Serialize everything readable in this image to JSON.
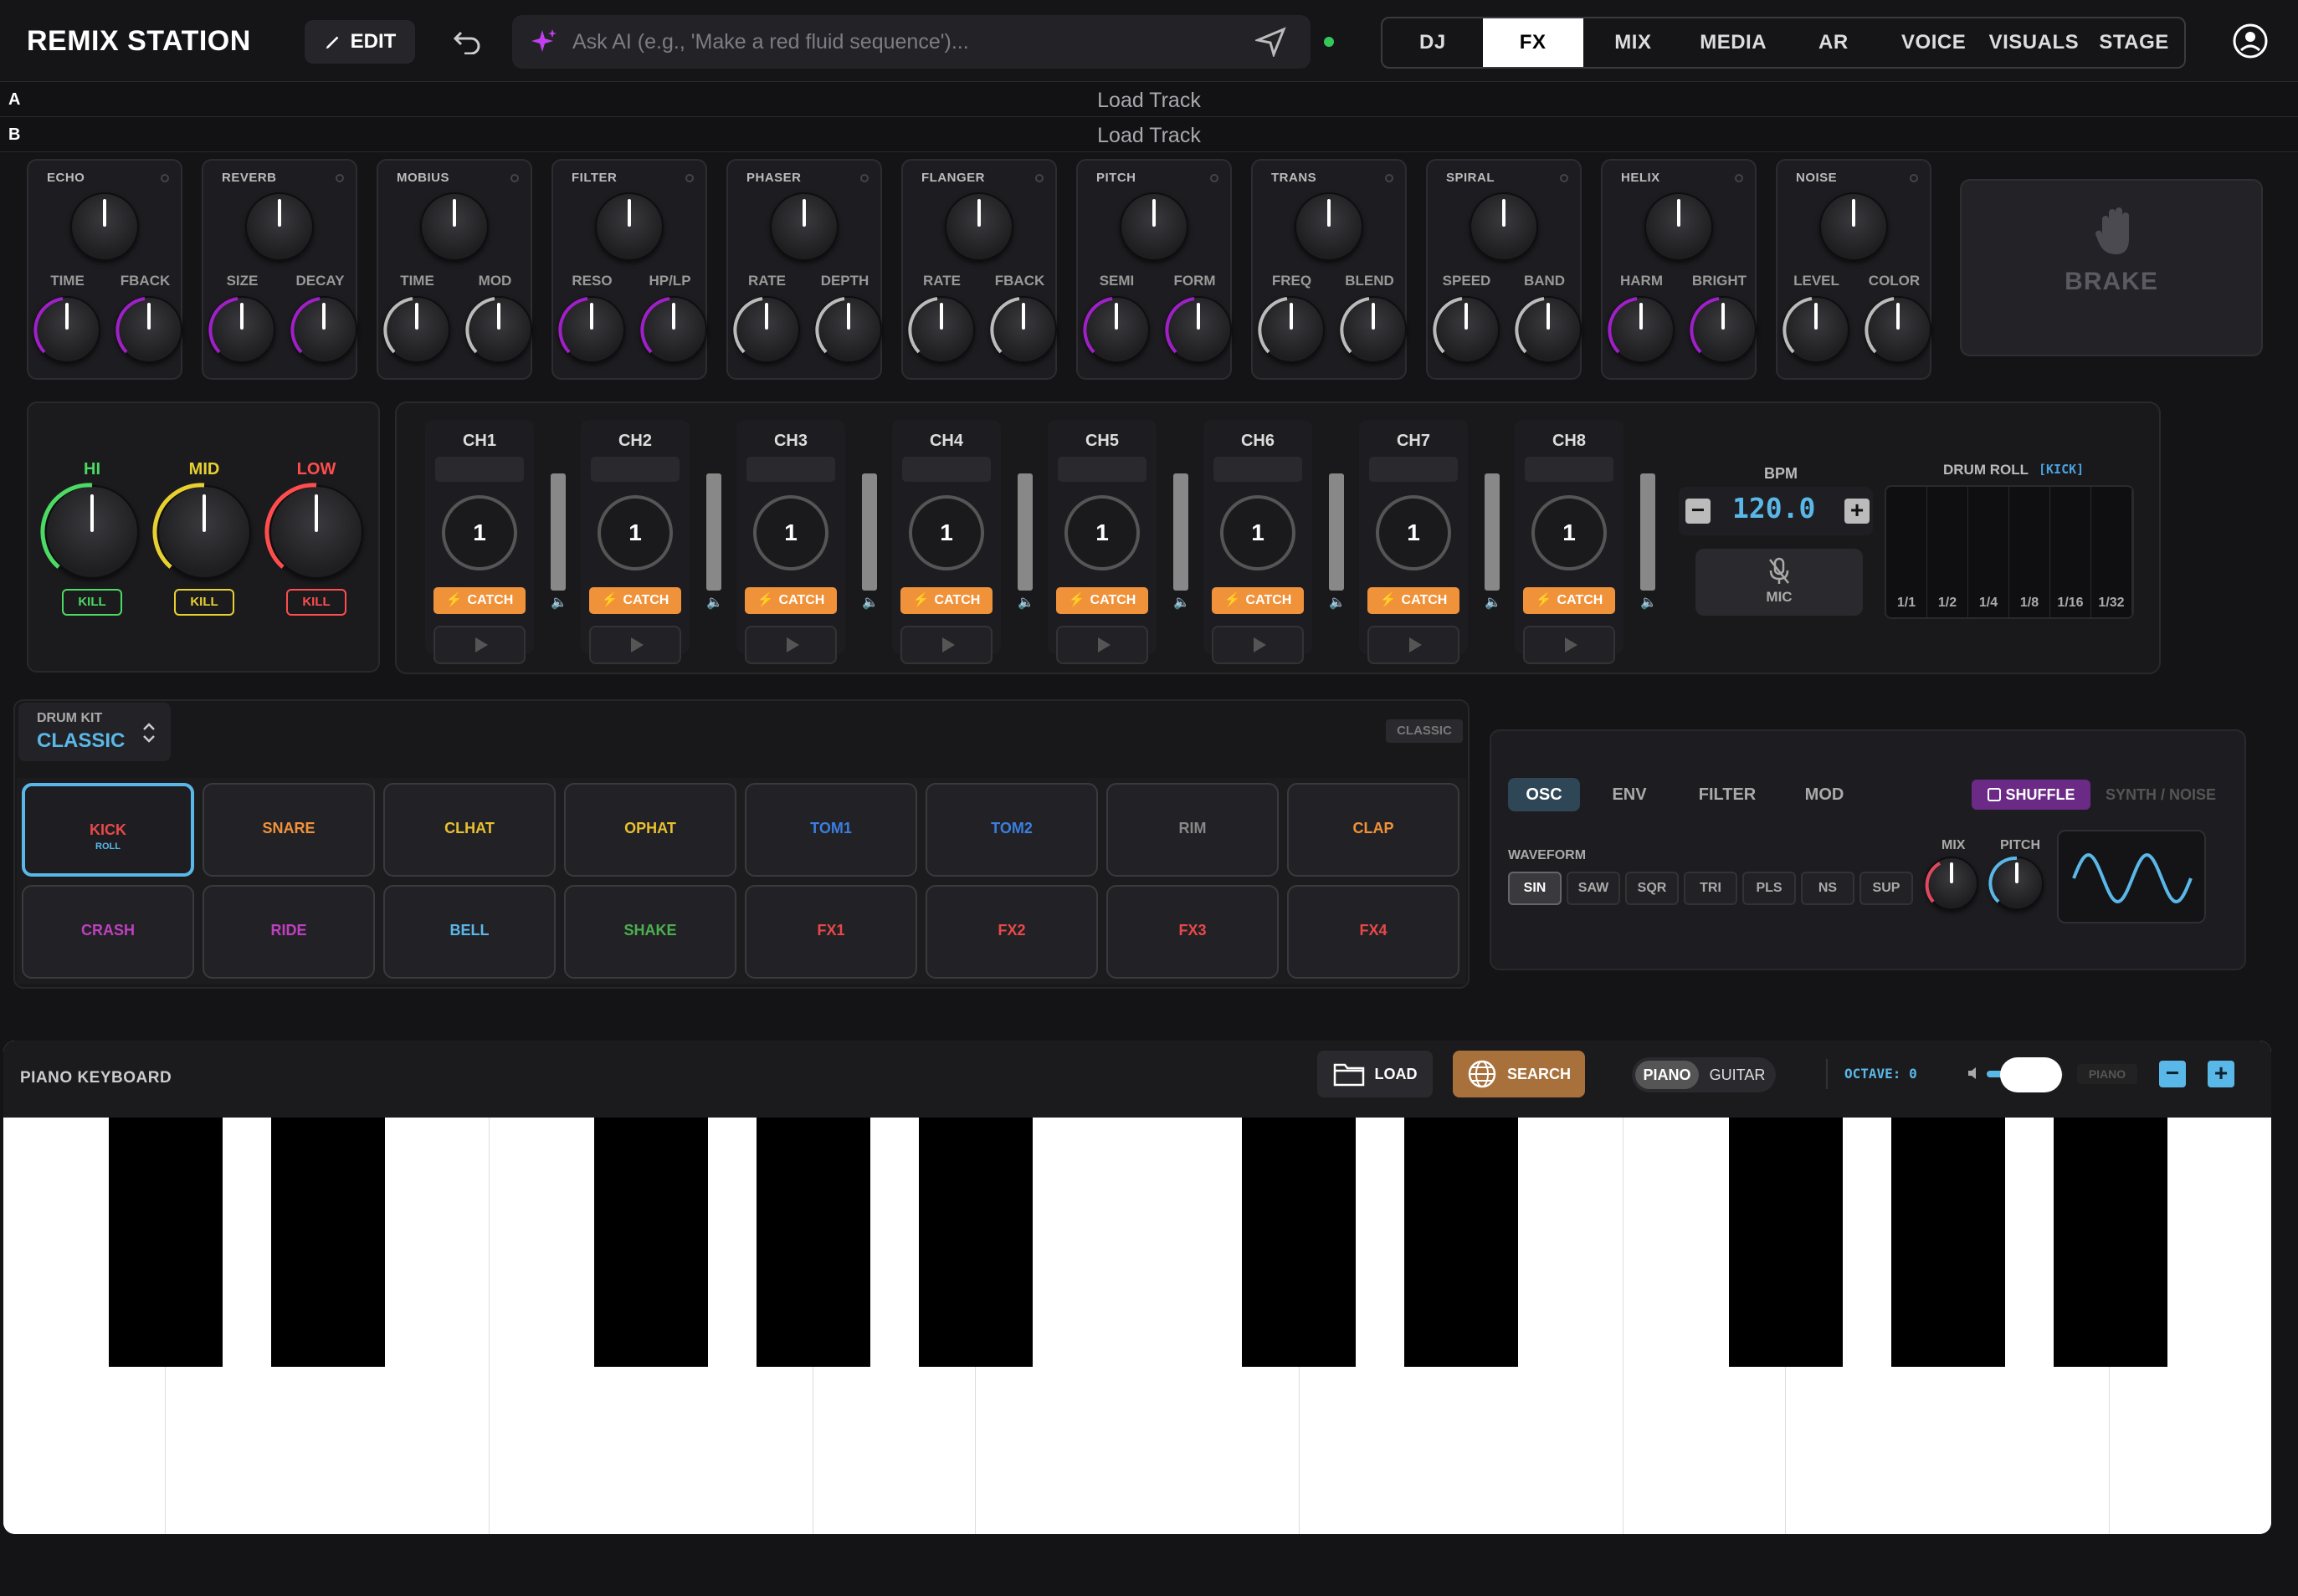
{
  "app": {
    "title": "REMIX STATION",
    "edit_label": "EDIT"
  },
  "ai": {
    "placeholder": "Ask AI (e.g., 'Make a red fluid sequence')..."
  },
  "tabs": [
    {
      "label": "DJ",
      "active": false
    },
    {
      "label": "FX",
      "active": true
    },
    {
      "label": "MIX",
      "active": false
    },
    {
      "label": "MEDIA",
      "active": false
    },
    {
      "label": "AR",
      "active": false
    },
    {
      "label": "VOICE",
      "active": false
    },
    {
      "label": "VISUALS",
      "active": false
    },
    {
      "label": "STAGE",
      "active": false
    }
  ],
  "tracks": [
    {
      "letter": "A",
      "text": "Load Track"
    },
    {
      "letter": "B",
      "text": "Load Track"
    }
  ],
  "fx": [
    {
      "name": "ECHO",
      "p1": "TIME",
      "p2": "FBACK",
      "accent": "#a020c8"
    },
    {
      "name": "REVERB",
      "p1": "SIZE",
      "p2": "DECAY",
      "accent": "#a020c8"
    },
    {
      "name": "MOBIUS",
      "p1": "TIME",
      "p2": "MOD",
      "accent": "#bbbbbb"
    },
    {
      "name": "FILTER",
      "p1": "RESO",
      "p2": "HP/LP",
      "accent": "#a020c8"
    },
    {
      "name": "PHASER",
      "p1": "RATE",
      "p2": "DEPTH",
      "accent": "#bbbbbb"
    },
    {
      "name": "FLANGER",
      "p1": "RATE",
      "p2": "FBACK",
      "accent": "#bbbbbb"
    },
    {
      "name": "PITCH",
      "p1": "SEMI",
      "p2": "FORM",
      "accent": "#a020c8"
    },
    {
      "name": "TRANS",
      "p1": "FREQ",
      "p2": "BLEND",
      "accent": "#bbbbbb"
    },
    {
      "name": "SPIRAL",
      "p1": "SPEED",
      "p2": "BAND",
      "accent": "#bbbbbb"
    },
    {
      "name": "HELIX",
      "p1": "HARM",
      "p2": "BRIGHT",
      "accent": "#a020c8"
    },
    {
      "name": "NOISE",
      "p1": "LEVEL",
      "p2": "COLOR",
      "accent": "#bbbbbb"
    }
  ],
  "brake": {
    "label": "BRAKE",
    "icon": "hand-icon"
  },
  "eq": [
    {
      "label": "HI",
      "kill": "KILL",
      "color": "#4cd964"
    },
    {
      "label": "MID",
      "kill": "KILL",
      "color": "#e8d030"
    },
    {
      "label": "LOW",
      "kill": "KILL",
      "color": "#ff4d4d"
    }
  ],
  "channels": [
    {
      "name": "CH1",
      "value": "1",
      "catch": "CATCH"
    },
    {
      "name": "CH2",
      "value": "1",
      "catch": "CATCH"
    },
    {
      "name": "CH3",
      "value": "1",
      "catch": "CATCH"
    },
    {
      "name": "CH4",
      "value": "1",
      "catch": "CATCH"
    },
    {
      "name": "CH5",
      "value": "1",
      "catch": "CATCH"
    },
    {
      "name": "CH6",
      "value": "1",
      "catch": "CATCH"
    },
    {
      "name": "CH7",
      "value": "1",
      "catch": "CATCH"
    },
    {
      "name": "CH8",
      "value": "1",
      "catch": "CATCH"
    }
  ],
  "bpm": {
    "label": "BPM",
    "value": "120.0",
    "minus": "−",
    "plus": "+"
  },
  "mic": {
    "label": "MIC"
  },
  "drum_roll": {
    "label": "DRUM ROLL",
    "tag": "[KICK]",
    "divisions": [
      "1/1",
      "1/2",
      "1/4",
      "1/8",
      "1/16",
      "1/32"
    ]
  },
  "drum_kit": {
    "label": "DRUM KIT",
    "value": "CLASSIC",
    "tag": "CLASSIC"
  },
  "pads": [
    {
      "label": "KICK",
      "sub": "ROLL",
      "color": "#e84848",
      "active": true
    },
    {
      "label": "SNARE",
      "color": "#f0923a"
    },
    {
      "label": "CLHAT",
      "color": "#e8c030"
    },
    {
      "label": "OPHAT",
      "color": "#e8c030"
    },
    {
      "label": "TOM1",
      "color": "#3a7ee0"
    },
    {
      "label": "TOM2",
      "color": "#3a7ee0"
    },
    {
      "label": "RIM",
      "color": "#888888"
    },
    {
      "label": "CLAP",
      "color": "#f0923a"
    },
    {
      "label": "CRASH",
      "color": "#c040c0"
    },
    {
      "label": "RIDE",
      "color": "#c040c0"
    },
    {
      "label": "BELL",
      "color": "#5ab8e8"
    },
    {
      "label": "SHAKE",
      "color": "#4caf50"
    },
    {
      "label": "FX1",
      "color": "#e84848"
    },
    {
      "label": "FX2",
      "color": "#e84848"
    },
    {
      "label": "FX3",
      "color": "#e84848"
    },
    {
      "label": "FX4",
      "color": "#e84848"
    }
  ],
  "synth": {
    "tabs": [
      "OSC",
      "ENV",
      "FILTER",
      "MOD"
    ],
    "active_tab": "OSC",
    "shuffle": "SHUFFLE",
    "mode": "SYNTH / NOISE",
    "waveform_label": "WAVEFORM",
    "waveforms": [
      "SIN",
      "SAW",
      "SQR",
      "TRI",
      "PLS",
      "NS",
      "SUP"
    ],
    "active_waveform": "SIN",
    "mix_label": "MIX",
    "pitch_label": "PITCH"
  },
  "keyboard": {
    "title": "PIANO KEYBOARD",
    "load": "LOAD",
    "search": "SEARCH",
    "piano": "PIANO",
    "guitar": "GUITAR",
    "octave": "OCTAVE: 0",
    "tag": "PIANO",
    "minus": "−",
    "plus": "+"
  }
}
